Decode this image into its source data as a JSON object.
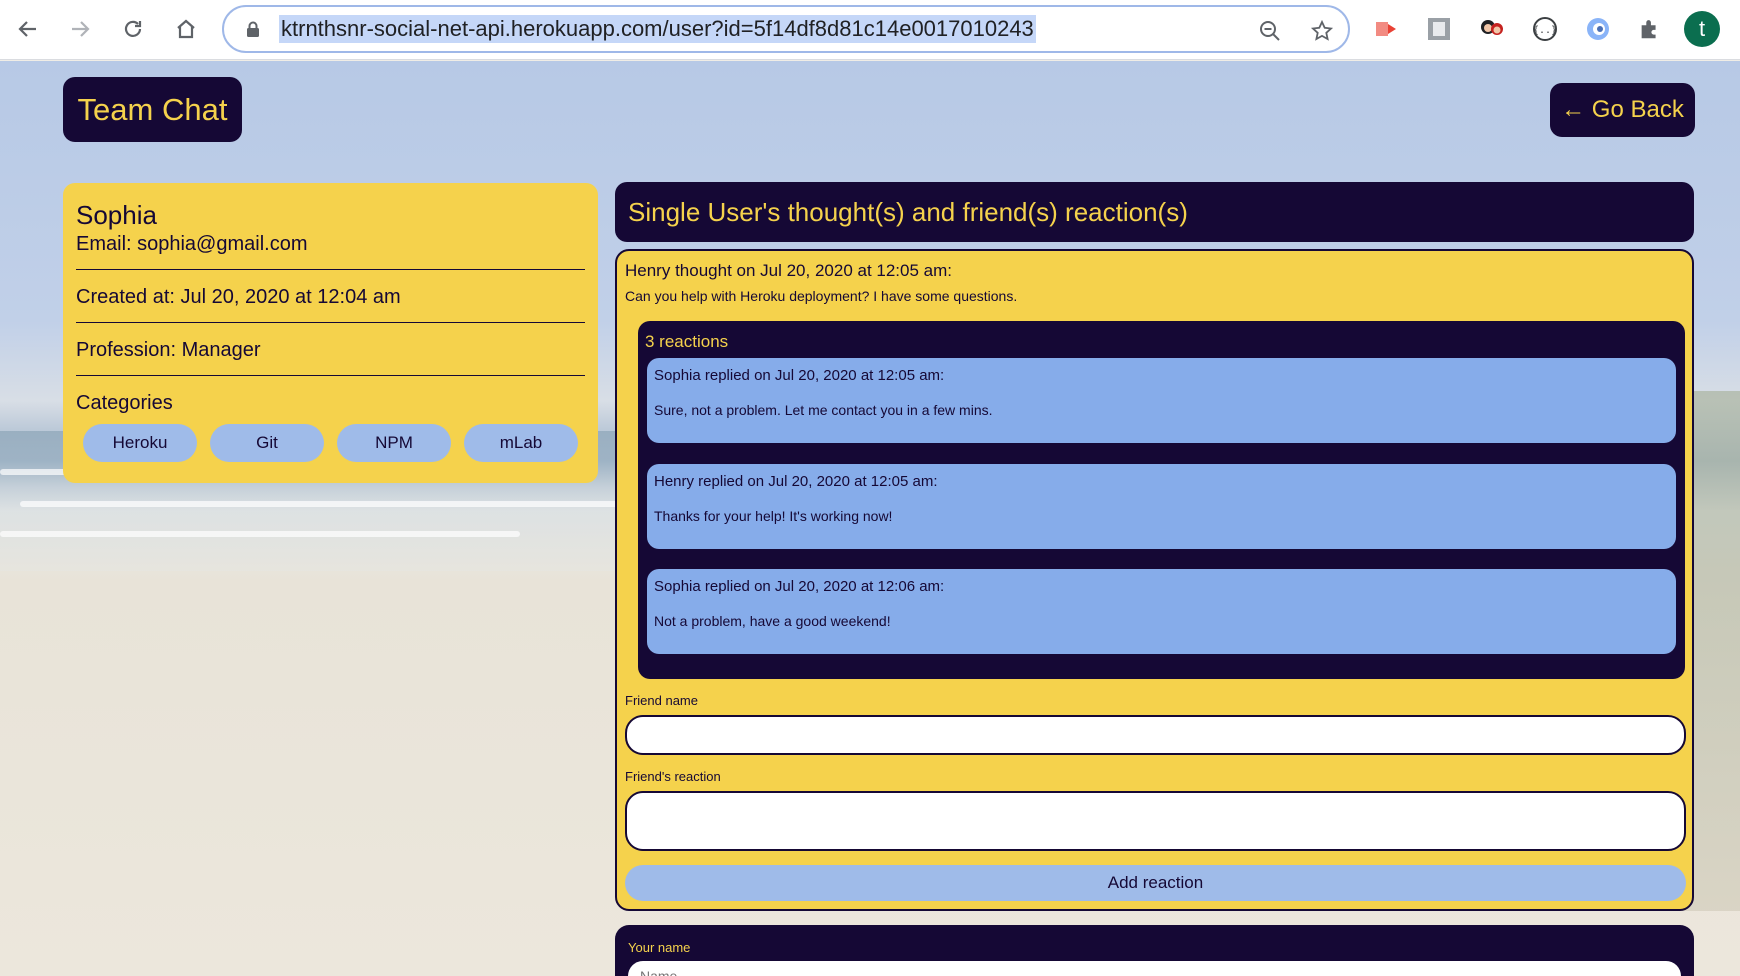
{
  "browser": {
    "url": "ktrnthsnr-social-net-api.herokuapp.com/user?id=5f14df8d81c14e0017010243",
    "profile_initial": "t"
  },
  "header": {
    "brand": "Team Chat",
    "back_label": "← Go Back"
  },
  "user": {
    "name": "Sophia",
    "email": "Email: sophia@gmail.com",
    "created": "Created at: Jul 20, 2020 at 12:04 am",
    "profession": "Profession: Manager",
    "categories_label": "Categories",
    "categories": [
      "Heroku",
      "Git",
      "NPM",
      "mLab"
    ]
  },
  "section_title": "Single User's thought(s) and friend(s) reaction(s)",
  "thought": {
    "header": "Henry thought on Jul 20, 2020 at 12:05 am:",
    "text": "Can you help with Heroku deployment? I have some questions.",
    "reactions_count": "3 reactions",
    "reactions": [
      {
        "header": "Sophia replied on Jul 20, 2020 at 12:05 am:",
        "text": "Sure, not a problem. Let me contact you in a few mins."
      },
      {
        "header": "Henry replied on Jul 20, 2020 at 12:05 am:",
        "text": "Thanks for your help! It's working now!"
      },
      {
        "header": "Sophia replied on Jul 20, 2020 at 12:06 am:",
        "text": "Not a problem, have a good weekend!"
      }
    ],
    "form": {
      "friend_name_label": "Friend name",
      "friend_reaction_label": "Friend's reaction",
      "submit_label": "Add reaction"
    }
  },
  "new_thought": {
    "your_name_label": "Your name",
    "your_name_placeholder": "Name"
  },
  "colors": {
    "navy": "#150835",
    "yellow": "#f5d24c",
    "blue": "#86acea",
    "light_blue": "#9fbbe9"
  }
}
